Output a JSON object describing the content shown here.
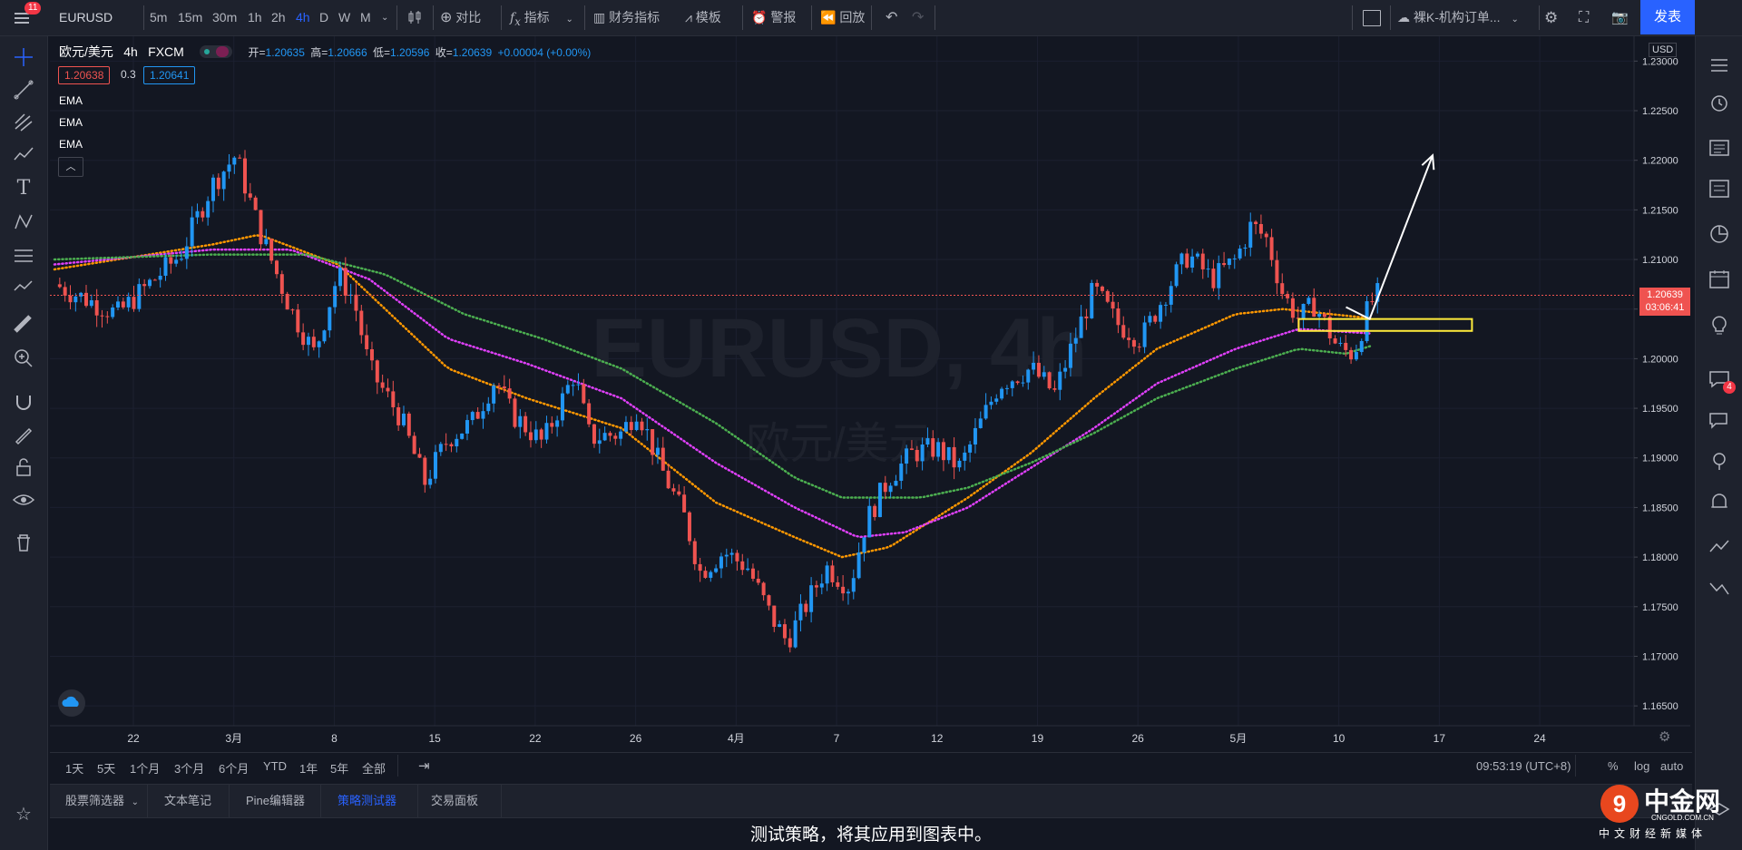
{
  "topbar": {
    "menu_badge": "11",
    "symbol": "EURUSD",
    "intervals": [
      "5m",
      "15m",
      "30m",
      "1h",
      "2h",
      "4h",
      "D",
      "W",
      "M"
    ],
    "active_interval": "4h",
    "compare_label": "对比",
    "indicators_label": "指标",
    "financials_label": "财务指标",
    "templates_label": "模板",
    "alert_label": "警报",
    "replay_label": "回放",
    "layout_name": "裸K-机构订单...",
    "publish_label": "发表"
  },
  "legend": {
    "pair": "欧元/美元",
    "interval": "4h",
    "source": "FXCM",
    "open_label": "开=",
    "open": "1.20635",
    "high_label": "高=",
    "high": "1.20666",
    "low_label": "低=",
    "low": "1.20596",
    "close_label": "收=",
    "close": "1.20639",
    "change": "+0.00004 (+0.00%)",
    "bid": "1.20638",
    "spread": "0.3",
    "ask": "1.20641",
    "indicators": [
      "EMA",
      "EMA",
      "EMA"
    ]
  },
  "chart_watermark": {
    "symbol_line": "EURUSD, 4h",
    "name_line": "欧元/美元"
  },
  "price_axis": {
    "currency": "USD",
    "ticks": [
      "1.23000",
      "1.22500",
      "1.22000",
      "1.21500",
      "1.21000",
      "1.20500",
      "1.20000",
      "1.19500",
      "1.19000",
      "1.18500",
      "1.18000",
      "1.17500",
      "1.17000",
      "1.16500"
    ],
    "last_price": "1.20639",
    "countdown": "03:06:41"
  },
  "time_axis": {
    "ticks": [
      "22",
      "3月",
      "8",
      "15",
      "22",
      "26",
      "4月",
      "7",
      "12",
      "19",
      "26",
      "5月",
      "10",
      "17",
      "24"
    ]
  },
  "range_bar": {
    "ranges": [
      "1天",
      "5天",
      "1个月",
      "3个月",
      "6个月",
      "YTD",
      "1年",
      "5年",
      "全部"
    ],
    "time": "09:53:19 (UTC+8)",
    "percent": "%",
    "log": "log",
    "auto": "auto"
  },
  "bottom_tabs": {
    "tabs": [
      "股票筛选器",
      "文本笔记",
      "Pine编辑器",
      "策略测试器",
      "交易面板"
    ],
    "active": "策略测试器",
    "message": "测试策略，将其应用到图表中。"
  },
  "right_toolbar": {
    "chat_badge": "4"
  },
  "site_watermark": {
    "brand": "中金网",
    "url": "CNGOLD.COM.CN",
    "tagline": "中文财经新媒体"
  },
  "colors": {
    "up": "#2196f3",
    "down": "#ef5350",
    "ema_fast": "#ff9800",
    "ema_mid": "#e040fb",
    "ema_slow": "#4caf50",
    "accent": "#2962ff",
    "zone": "#ffeb3b"
  },
  "chart_data": {
    "type": "candlestick",
    "symbol": "EURUSD",
    "interval": "4h",
    "ylim": [
      1.163,
      1.2325
    ],
    "x_ticks": [
      "22",
      "3月",
      "8",
      "15",
      "22",
      "26",
      "4月",
      "7",
      "12",
      "19",
      "26",
      "5月",
      "10",
      "17",
      "24"
    ],
    "trend_points": [
      [
        0.0,
        1.2075
      ],
      [
        0.04,
        1.2045
      ],
      [
        0.08,
        1.2105
      ],
      [
        0.1,
        1.2175
      ],
      [
        0.115,
        1.2205
      ],
      [
        0.13,
        1.213
      ],
      [
        0.15,
        1.205
      ],
      [
        0.165,
        1.2005
      ],
      [
        0.18,
        1.2085
      ],
      [
        0.19,
        1.206
      ],
      [
        0.2,
        1.199
      ],
      [
        0.22,
        1.194
      ],
      [
        0.235,
        1.1875
      ],
      [
        0.25,
        1.192
      ],
      [
        0.265,
        1.1935
      ],
      [
        0.28,
        1.198
      ],
      [
        0.29,
        1.1945
      ],
      [
        0.31,
        1.1915
      ],
      [
        0.33,
        1.1985
      ],
      [
        0.34,
        1.192
      ],
      [
        0.36,
        1.1925
      ],
      [
        0.37,
        1.195
      ],
      [
        0.385,
        1.189
      ],
      [
        0.4,
        1.184
      ],
      [
        0.41,
        1.1785
      ],
      [
        0.425,
        1.1805
      ],
      [
        0.44,
        1.179
      ],
      [
        0.455,
        1.174
      ],
      [
        0.465,
        1.1715
      ],
      [
        0.475,
        1.1745
      ],
      [
        0.49,
        1.179
      ],
      [
        0.505,
        1.177
      ],
      [
        0.515,
        1.1835
      ],
      [
        0.53,
        1.188
      ],
      [
        0.545,
        1.1905
      ],
      [
        0.56,
        1.191
      ],
      [
        0.575,
        1.189
      ],
      [
        0.585,
        1.1925
      ],
      [
        0.6,
        1.1975
      ],
      [
        0.62,
        1.199
      ],
      [
        0.635,
        1.1965
      ],
      [
        0.65,
        1.203
      ],
      [
        0.66,
        1.207
      ],
      [
        0.675,
        1.2035
      ],
      [
        0.69,
        1.202
      ],
      [
        0.71,
        1.208
      ],
      [
        0.72,
        1.2105
      ],
      [
        0.735,
        1.208
      ],
      [
        0.75,
        1.21
      ],
      [
        0.76,
        1.2135
      ],
      [
        0.77,
        1.212
      ],
      [
        0.78,
        1.2065
      ],
      [
        0.79,
        1.204
      ],
      [
        0.8,
        1.2055
      ],
      [
        0.815,
        1.201
      ],
      [
        0.825,
        1.2005
      ],
      [
        0.835,
        1.2055
      ],
      [
        0.84,
        1.2064
      ]
    ],
    "ema_series": [
      {
        "points": [
          [
            0.0,
            1.209
          ],
          [
            0.1,
            1.2115
          ],
          [
            0.13,
            1.2125
          ],
          [
            0.18,
            1.2095
          ],
          [
            0.25,
            1.199
          ],
          [
            0.3,
            1.196
          ],
          [
            0.36,
            1.193
          ],
          [
            0.42,
            1.1855
          ],
          [
            0.47,
            1.182
          ],
          [
            0.5,
            1.18
          ],
          [
            0.53,
            1.181
          ],
          [
            0.58,
            1.186
          ],
          [
            0.62,
            1.1905
          ],
          [
            0.66,
            1.196
          ],
          [
            0.7,
            1.201
          ],
          [
            0.75,
            1.2045
          ],
          [
            0.78,
            1.205
          ],
          [
            0.81,
            1.2045
          ],
          [
            0.84,
            1.204
          ]
        ]
      },
      {
        "points": [
          [
            0.0,
            1.2095
          ],
          [
            0.1,
            1.211
          ],
          [
            0.15,
            1.211
          ],
          [
            0.2,
            1.208
          ],
          [
            0.25,
            1.202
          ],
          [
            0.3,
            1.1995
          ],
          [
            0.36,
            1.196
          ],
          [
            0.42,
            1.1895
          ],
          [
            0.47,
            1.185
          ],
          [
            0.51,
            1.182
          ],
          [
            0.54,
            1.1825
          ],
          [
            0.58,
            1.185
          ],
          [
            0.62,
            1.189
          ],
          [
            0.66,
            1.193
          ],
          [
            0.7,
            1.1975
          ],
          [
            0.75,
            1.201
          ],
          [
            0.79,
            1.203
          ],
          [
            0.84,
            1.2025
          ]
        ]
      },
      {
        "points": [
          [
            0.0,
            1.21
          ],
          [
            0.1,
            1.2105
          ],
          [
            0.16,
            1.2105
          ],
          [
            0.21,
            1.2085
          ],
          [
            0.26,
            1.2045
          ],
          [
            0.31,
            1.202
          ],
          [
            0.36,
            1.199
          ],
          [
            0.42,
            1.1935
          ],
          [
            0.47,
            1.188
          ],
          [
            0.5,
            1.186
          ],
          [
            0.55,
            1.186
          ],
          [
            0.58,
            1.187
          ],
          [
            0.62,
            1.1895
          ],
          [
            0.66,
            1.1925
          ],
          [
            0.7,
            1.196
          ],
          [
            0.75,
            1.199
          ],
          [
            0.79,
            1.201
          ],
          [
            0.82,
            1.2005
          ],
          [
            0.84,
            1.2015
          ]
        ]
      }
    ],
    "zone": {
      "x_start": 0.79,
      "x_end": 0.9,
      "y_top": 1.204,
      "y_bottom": 1.2028
    },
    "projection_arrow": {
      "from": [
        0.82,
        1.2052
      ],
      "via": [
        0.835,
        1.204
      ],
      "to": [
        0.875,
        1.2205
      ]
    }
  }
}
